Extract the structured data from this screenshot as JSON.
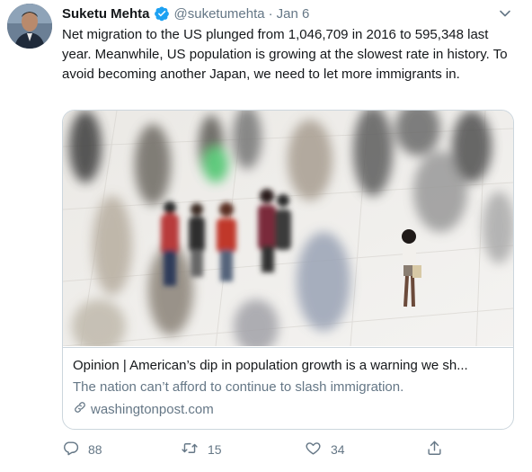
{
  "tweet": {
    "author_name": "Suketu Mehta",
    "handle": "@suketumehta",
    "separator": "·",
    "date": "Jan 6",
    "text": "Net migration to the US plunged from 1,046,709 in 2016 to 595,348 last year. Meanwhile, US population is growing at the slowest rate in history. To avoid becoming another Japan, we need to let more immigrants in."
  },
  "card": {
    "title": "Opinion | American’s dip in population growth is a warning we sh...",
    "description": "The nation can’t afford to continue to slash immigration.",
    "domain": "washingtonpost.com"
  },
  "actions": {
    "replies": "88",
    "retweets": "15",
    "likes": "34"
  },
  "icons": {
    "verified": "verified-badge-icon",
    "caret": "chevron-down-icon",
    "reply": "reply-icon",
    "retweet": "retweet-icon",
    "like": "heart-icon",
    "share": "share-icon",
    "link": "link-icon"
  },
  "colors": {
    "verified": "#1da1f2",
    "secondary_text": "#657786",
    "primary_text": "#14171a",
    "border": "#ccd6dd"
  }
}
